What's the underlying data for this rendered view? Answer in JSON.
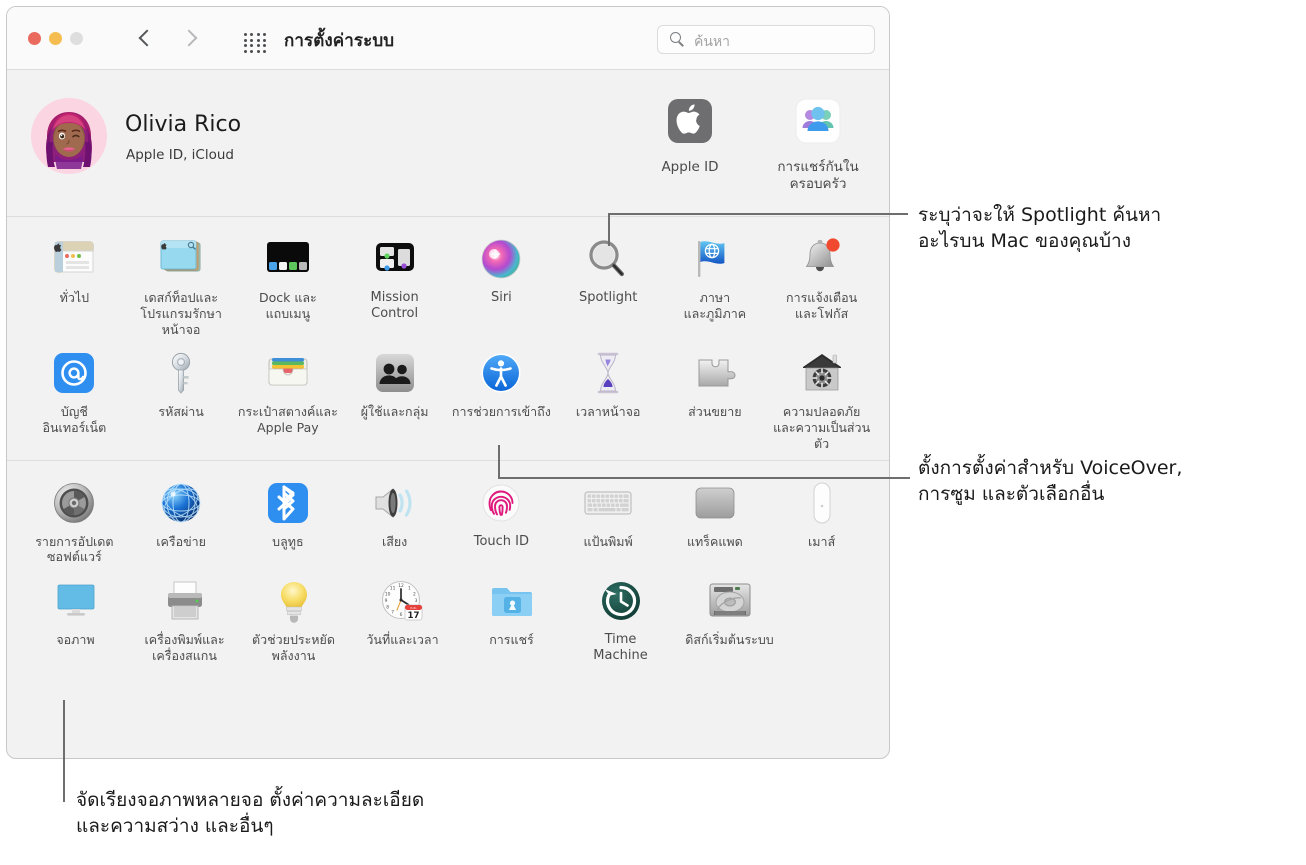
{
  "window": {
    "title": "การตั้งค่าระบบ",
    "traffic_lights": [
      "close",
      "minimize",
      "zoom"
    ],
    "nav_back": "back-arrow",
    "nav_forward": "forward-arrow",
    "grid_button": "show-all-grid",
    "search": {
      "placeholder": "ค้นหา",
      "value": "",
      "icon": "search-icon"
    }
  },
  "account": {
    "name": "Olivia Rico",
    "subtitle": "Apple ID, iCloud",
    "avatar": "memoji-avatar",
    "tiles": [
      {
        "label": "Apple ID",
        "icon": "apple-logo-icon"
      },
      {
        "label": "การแชร์กันใน\nครอบครัว",
        "icon": "family-sharing-icon"
      }
    ]
  },
  "sections": [
    {
      "name": "personal",
      "rows": [
        [
          {
            "label": "ทั่วไป",
            "icon": "general-icon"
          },
          {
            "label": "เดสก์ท็อปและ\nโปรแกรมรักษาหน้าจอ",
            "icon": "desktop-screensaver-icon"
          },
          {
            "label": "Dock และ\nแถบเมนู",
            "icon": "dock-menubar-icon"
          },
          {
            "label": "Mission\nControl",
            "icon": "mission-control-icon",
            "latin": true
          },
          {
            "label": "Siri",
            "icon": "siri-icon",
            "latin": true
          },
          {
            "label": "Spotlight",
            "icon": "spotlight-icon",
            "latin": true
          },
          {
            "label": "ภาษา\nและภูมิภาค",
            "icon": "language-region-icon"
          },
          {
            "label": "การแจ้งเตือน\nและโฟกัส",
            "icon": "notifications-focus-icon"
          }
        ],
        [
          {
            "label": "บัญชี\nอินเทอร์เน็ต",
            "icon": "internet-accounts-icon"
          },
          {
            "label": "รหัสผ่าน",
            "icon": "passwords-key-icon"
          },
          {
            "label": "กระเป๋าสตางค์และ\nApple Pay",
            "icon": "wallet-applepay-icon"
          },
          {
            "label": "ผู้ใช้และกลุ่ม",
            "icon": "users-groups-icon"
          },
          {
            "label": "การช่วยการเข้าถึง",
            "icon": "accessibility-icon"
          },
          {
            "label": "เวลาหน้าจอ",
            "icon": "screen-time-icon"
          },
          {
            "label": "ส่วนขยาย",
            "icon": "extensions-puzzle-icon"
          },
          {
            "label": "ความปลอดภัย\nและความเป็นส่วนตัว",
            "icon": "security-privacy-icon"
          }
        ]
      ]
    },
    {
      "name": "hardware",
      "rows": [
        [
          {
            "label": "รายการอัปเดต\nซอฟต์แวร์",
            "icon": "software-update-icon"
          },
          {
            "label": "เครือข่าย",
            "icon": "network-globe-icon"
          },
          {
            "label": "บลูทูธ",
            "icon": "bluetooth-icon"
          },
          {
            "label": "เสียง",
            "icon": "sound-icon"
          },
          {
            "label": "Touch ID",
            "icon": "touch-id-icon",
            "latin": true
          },
          {
            "label": "แป้นพิมพ์",
            "icon": "keyboard-icon"
          },
          {
            "label": "แทร็คแพด",
            "icon": "trackpad-icon"
          },
          {
            "label": "เมาส์",
            "icon": "mouse-icon"
          }
        ],
        [
          {
            "label": "จอภาพ",
            "icon": "displays-icon"
          },
          {
            "label": "เครื่องพิมพ์และ\nเครื่องสแกน",
            "icon": "printers-scanners-icon"
          },
          {
            "label": "ตัวช่วยประหยัด\nพลังงาน",
            "icon": "energy-saver-icon"
          },
          {
            "label": "วันที่และเวลา",
            "icon": "date-time-icon"
          },
          {
            "label": "การแชร์",
            "icon": "sharing-folder-icon"
          },
          {
            "label": "Time\nMachine",
            "icon": "time-machine-icon",
            "latin": true
          },
          {
            "label": "ดิสก์เริ่มต้นระบบ",
            "icon": "startup-disk-icon"
          }
        ]
      ]
    }
  ],
  "callouts": [
    {
      "id": "spotlight-callout",
      "text": "ระบุว่าจะให้ Spotlight ค้นหา\nอะไรบน Mac ของคุณบ้าง"
    },
    {
      "id": "accessibility-callout",
      "text": "ตั้งการตั้งค่าสำหรับ VoiceOver,\nการซูม และตัวเลือกอื่น"
    },
    {
      "id": "displays-callout",
      "text": "จัดเรียงจอภาพหลายจอ ตั้งค่าความละเอียด\nและความสว่าง และอื่นๆ"
    }
  ],
  "colors": {
    "window_bg": "#f2f2f2",
    "toolbar_bg": "#fafafa",
    "label": "#4c4c4c",
    "accent_blue": "#1a7ef5",
    "leader_line": "#6e6e6e"
  }
}
